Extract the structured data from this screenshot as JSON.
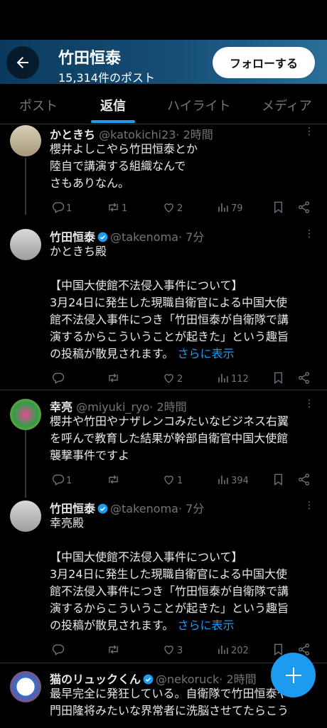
{
  "header": {
    "title": "竹田恒泰",
    "post_count": "15,314件のポスト",
    "follow_label": "フォローする",
    "gradient": [
      "#0b3a5e",
      "#2a6e98"
    ]
  },
  "tabs": [
    "ポスト",
    "返信",
    "ハイライト",
    "メディア"
  ],
  "active_tab": "返信",
  "accent": "#1d9bf0",
  "tweets": [
    {
      "name": "かときち",
      "handle": "@katokichi23",
      "time": "· 2時間",
      "verified": false,
      "lines": [
        "櫻井よしこやら竹田恒泰とか",
        "陸自で講演する組織なんで",
        "さもありなん。"
      ],
      "show_more": "",
      "stats": {
        "replies": "1",
        "reposts": "1",
        "likes": "2",
        "views": "79"
      }
    },
    {
      "name": "竹田恒泰",
      "handle": "@takenoma",
      "time": "· 7分",
      "verified": true,
      "lines": [
        "かときち殿",
        "",
        "【中国大使館不法侵入事件について】",
        "3月24日に発生した現職自衛官による中国大使",
        "館不法侵入事件につき「竹田恒泰が自衛隊で講",
        "演するからこういうことが起きた」という趣旨",
        "の投稿が散見されます。"
      ],
      "show_more": "さらに表示",
      "stats": {
        "replies": "",
        "reposts": "",
        "likes": "2",
        "views": "112"
      }
    },
    {
      "name": "幸亮",
      "handle": "@miyuki_ryo",
      "time": "· 2時間",
      "verified": false,
      "lines": [
        "櫻井や竹田やナザレンコみたいなビジネス右翼",
        "を呼んで教育した結果が幹部自衛官中国大使館",
        "襲撃事件ですよ"
      ],
      "show_more": "",
      "stats": {
        "replies": "1",
        "reposts": "",
        "likes": "1",
        "views": "394"
      }
    },
    {
      "name": "竹田恒泰",
      "handle": "@takenoma",
      "time": "· 7分",
      "verified": true,
      "lines": [
        "幸亮殿",
        "",
        "【中国大使館不法侵入事件について】",
        "3月24日に発生した現職自衛官による中国大使",
        "館不法侵入事件につき「竹田恒泰が自衛隊で講",
        "演するからこういうことが起きた」という趣旨",
        "の投稿が散見されます。"
      ],
      "show_more": "さらに表示",
      "stats": {
        "replies": "",
        "reposts": "",
        "likes": "3",
        "views": "202"
      }
    },
    {
      "name": "猫のリュックくん",
      "handle": "@nekoruck",
      "time": "· 2時間",
      "verified": true,
      "lines": [
        "最早完全に発狂している。自衛隊で竹田恒泰や",
        "門田隆将みたいな界常者に洗脳させてたらこう"
      ],
      "show_more": "",
      "stats": {
        "replies": "",
        "reposts": "",
        "likes": "",
        "views": ""
      }
    }
  ]
}
